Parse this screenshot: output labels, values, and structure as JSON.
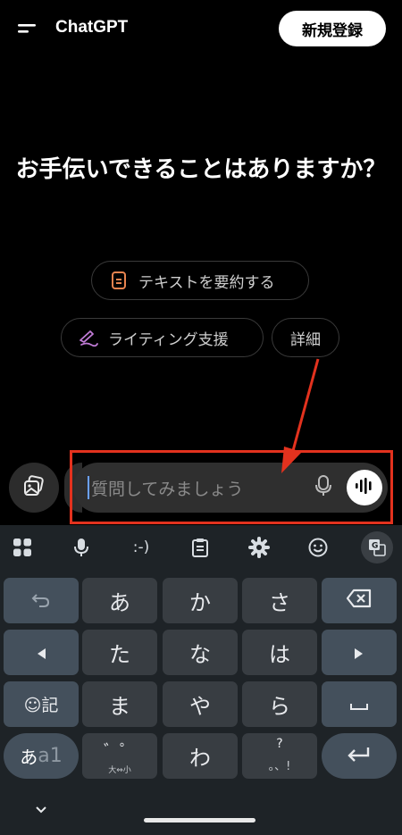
{
  "header": {
    "app_title": "ChatGPT",
    "signup_label": "新規登録"
  },
  "main": {
    "headline": "お手伝いできることはありますか？",
    "suggestions": [
      {
        "label": "テキストを要約する",
        "icon": "document-icon",
        "icon_color": "#e8834f"
      },
      {
        "label": "ライティング支援",
        "icon": "pen-icon",
        "icon_color": "#c07bd6"
      },
      {
        "label": "詳細"
      }
    ]
  },
  "composer": {
    "placeholder": "質問してみましょう",
    "value": ""
  },
  "keyboard": {
    "toolbar": {
      "emoticon_label": ":-)"
    },
    "rows": [
      [
        "undo",
        "あ",
        "か",
        "さ",
        "backspace"
      ],
      [
        "left",
        "た",
        "な",
        "は",
        "right"
      ],
      [
        "emoji_symbol",
        "ま",
        "や",
        "ら",
        "space"
      ],
      [
        "mode",
        "dakuten",
        "わ",
        "punct",
        "enter"
      ]
    ],
    "labels": {
      "a": "あ",
      "ka": "か",
      "sa": "さ",
      "ta": "た",
      "na": "な",
      "ha": "は",
      "ma": "ま",
      "ya": "や",
      "ra": "ら",
      "wa": "わ",
      "emoji_symbol": "☺記",
      "mode_kana": "あ",
      "mode_alpha": "a1",
      "dakuten_top": "゛゜",
      "dakuten_sub": "大⇔小",
      "punct_top": "?",
      "punct_bottom": "。、!"
    }
  },
  "colors": {
    "accent_red": "#e3321e",
    "keyboard_bg": "#1e2327",
    "key_bg": "#383d42",
    "fn_key_bg": "#44505c"
  }
}
